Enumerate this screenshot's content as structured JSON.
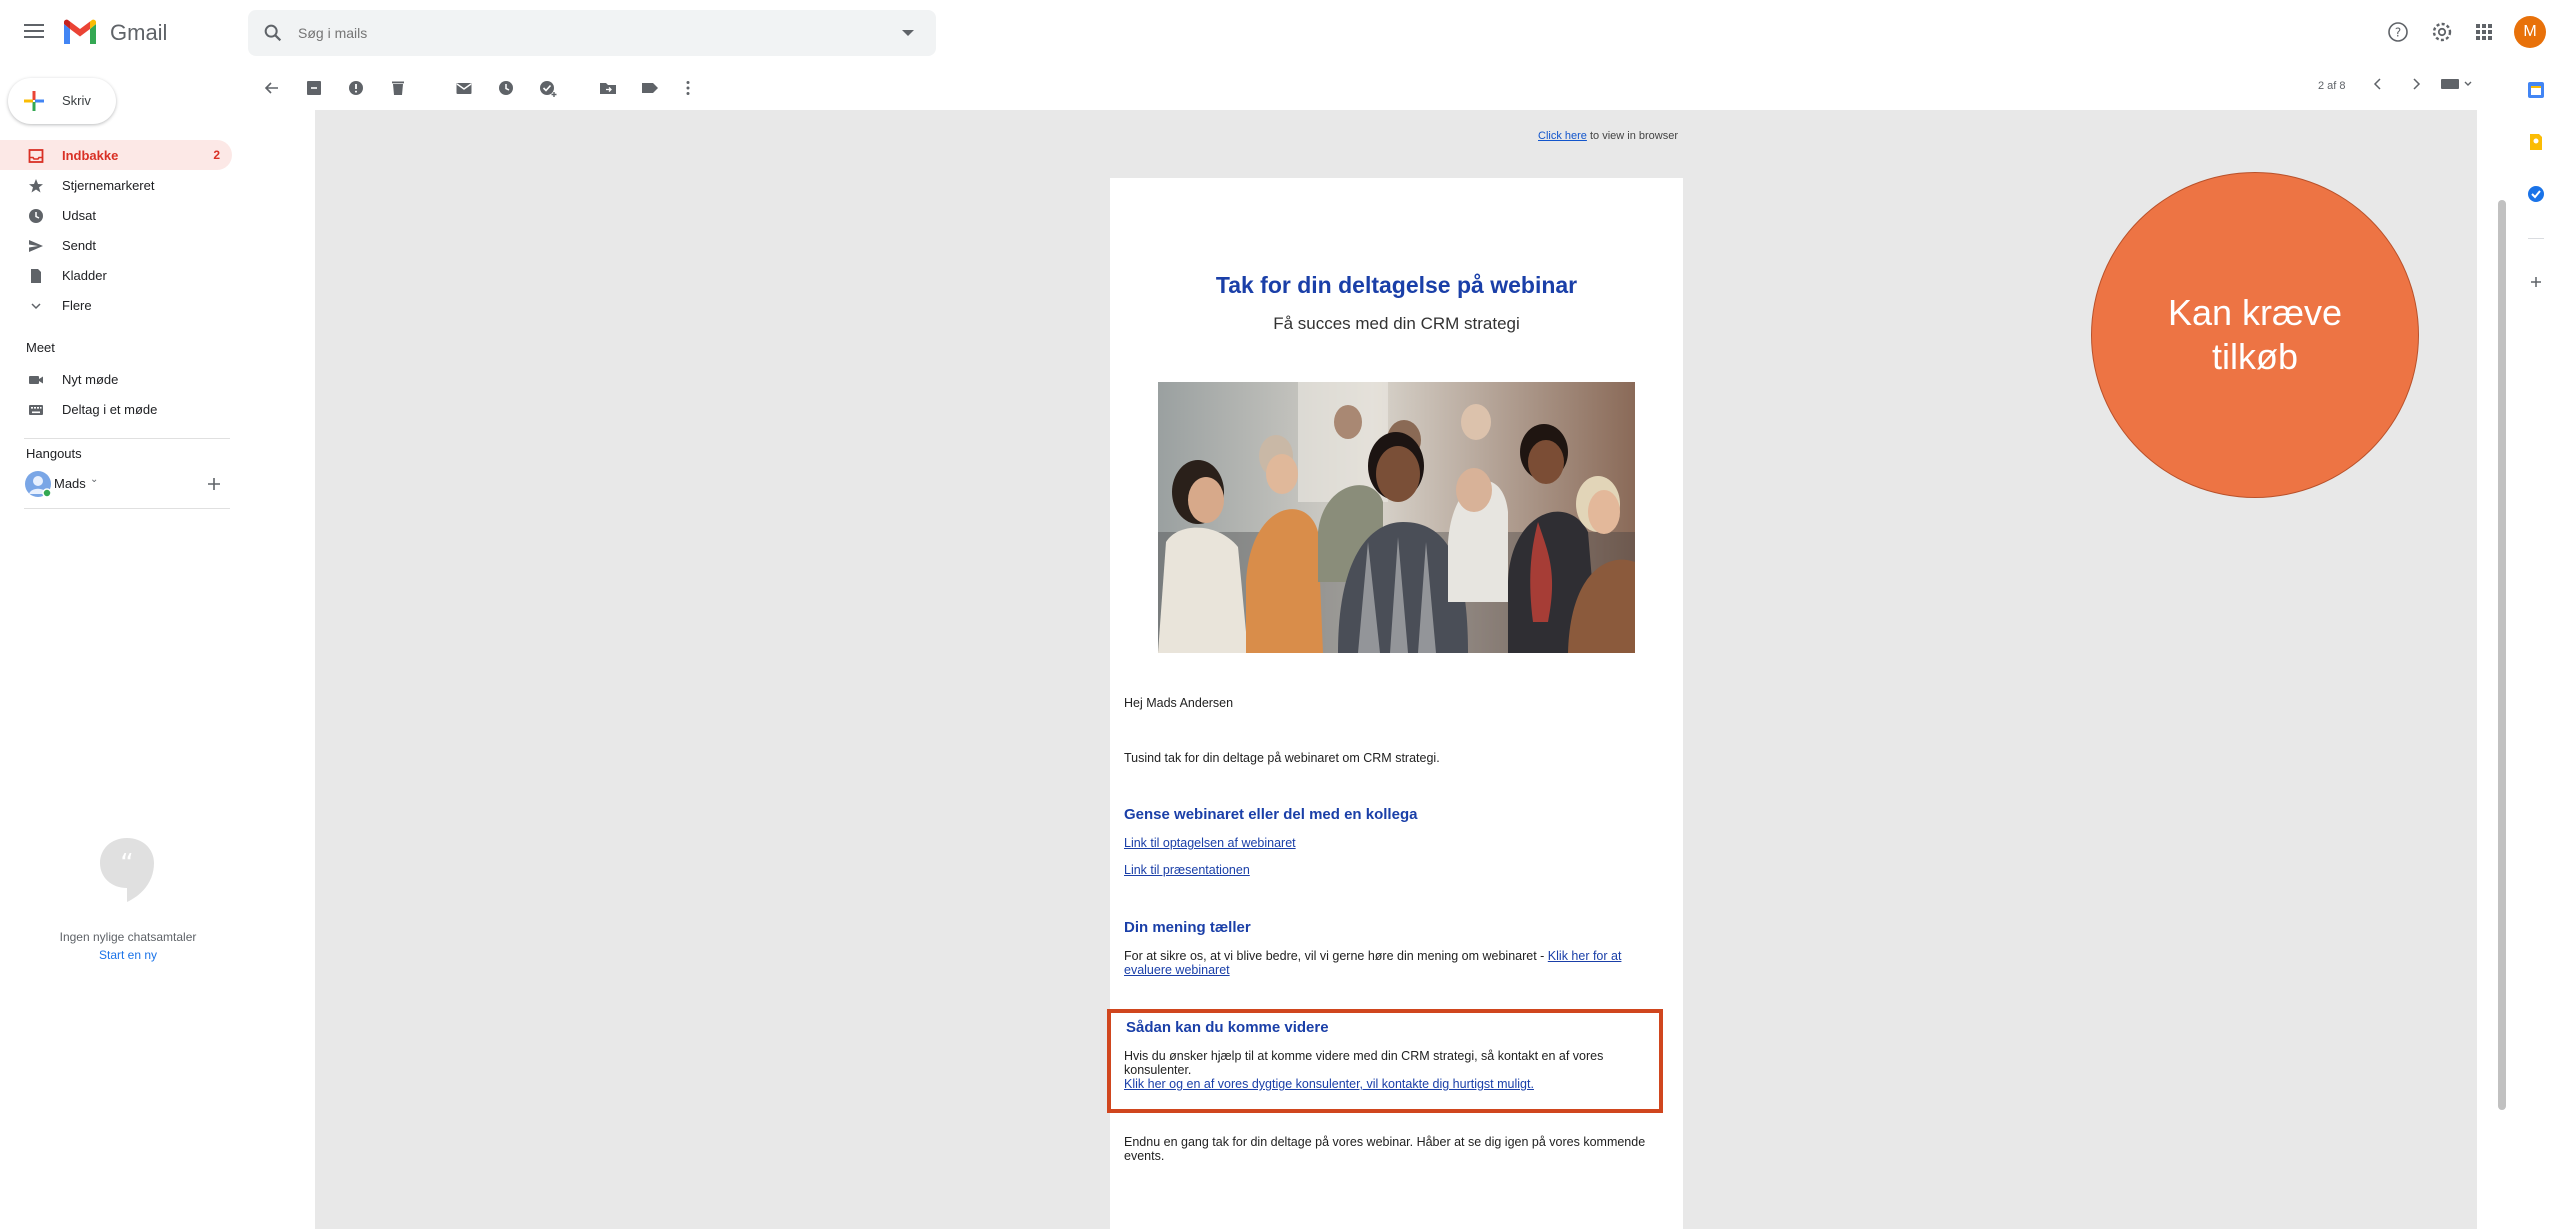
{
  "app": {
    "brand": "Gmail",
    "avatar_letter": "M"
  },
  "search": {
    "placeholder": "Søg i mails"
  },
  "compose": {
    "label": "Skriv"
  },
  "nav": {
    "items": [
      {
        "label": "Indbakke",
        "count": "2"
      },
      {
        "label": "Stjernemarkeret"
      },
      {
        "label": "Udsat"
      },
      {
        "label": "Sendt"
      },
      {
        "label": "Kladder"
      },
      {
        "label": "Flere"
      }
    ],
    "meet_title": "Meet",
    "meet_items": [
      {
        "label": "Nyt møde"
      },
      {
        "label": "Deltag i et møde"
      }
    ],
    "hangouts_title": "Hangouts",
    "hangouts_user": "Mads",
    "chat_empty": "Ingen nylige chatsamtaler",
    "chat_start": "Start en ny"
  },
  "toolbar": {
    "pager": "2 af 8"
  },
  "email": {
    "view_link": "Click here",
    "view_suffix": " to view in browser",
    "title": "Tak for din deltagelse på webinar",
    "subtitle": "Få succes med din CRM strategi",
    "greeting": "Hej Mads Andersen",
    "thanks": "Tusind tak for din deltage på webinaret om CRM strategi.",
    "h1": "Gense webinaret eller del med en kollega",
    "link1": "Link til optagelsen af webinaret",
    "link2": "Link til præsentationen",
    "h2": "Din mening tæller",
    "opinion_text": "For at sikre os, at vi blive bedre, vil vi gerne høre din mening om webinaret - ",
    "opinion_link": "Klik her for at evaluere webinaret",
    "h3": "Sådan kan du komme videre",
    "next_text": "Hvis du ønsker hjælp til at komme videre med din CRM strategi, så kontakt en af vores konsulenter.",
    "next_link": "Klik her og en af vores dygtige konsulenter, vil kontakte dig hurtigst muligt.",
    "closing": "Endnu en gang tak for din deltage på vores webinar. Håber at se dig igen på vores kommende events."
  },
  "callout": {
    "text": "Kan kræve tilkøb"
  },
  "colors": {
    "accent_red": "#d93025",
    "email_heading": "#1a3fa8",
    "callout": "#ed7444",
    "highlight_border": "#d0461e"
  }
}
